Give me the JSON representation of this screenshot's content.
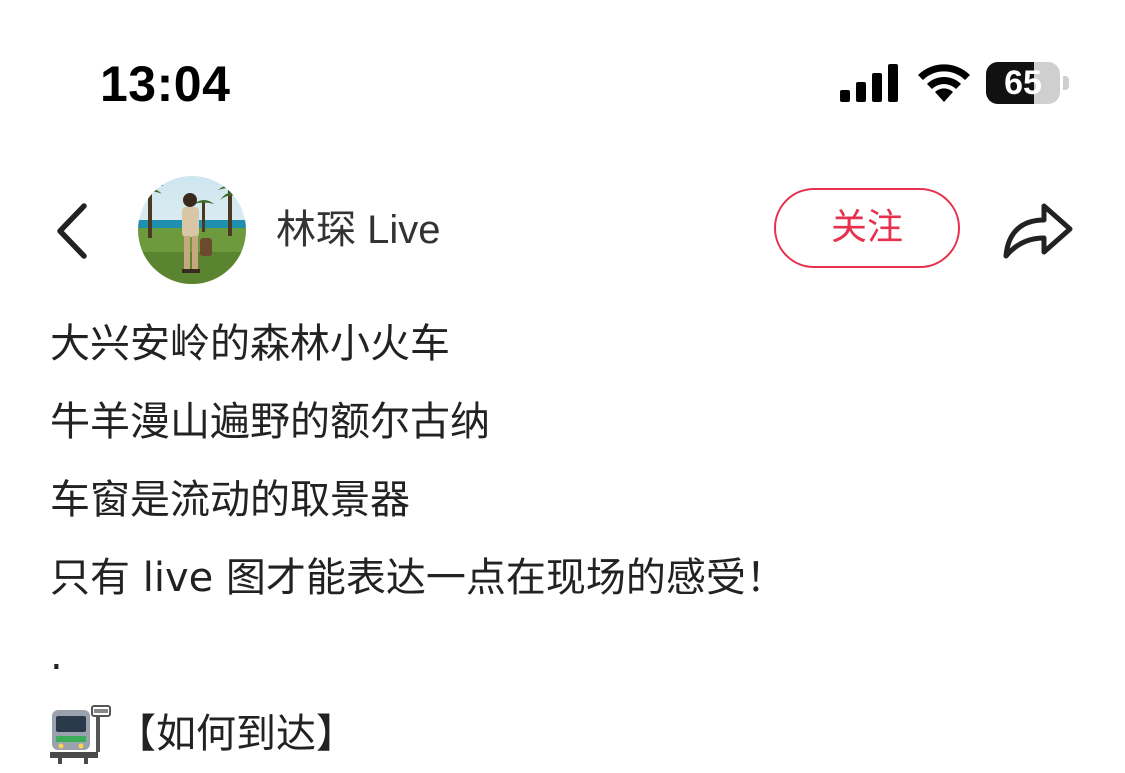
{
  "status_bar": {
    "time": "13:04",
    "battery_level": "65",
    "battery_fraction": 0.65,
    "icons": [
      "signal-icon",
      "wifi-icon",
      "battery-icon"
    ]
  },
  "header": {
    "back_icon": "chevron-left-icon",
    "author_name": "林琛 Live",
    "follow_label": "关注",
    "share_icon": "share-arrow-icon",
    "accent_color": "#e6304d"
  },
  "post": {
    "lines": [
      "大兴安岭的森林小火车",
      "牛羊漫山遍野的额尔古纳",
      "车窗是流动的取景器",
      "只有 live 图才能表达一点在现场的感受！"
    ],
    "separator": ".",
    "route_icon": "train-icon",
    "route_heading": "【如何到达】"
  }
}
